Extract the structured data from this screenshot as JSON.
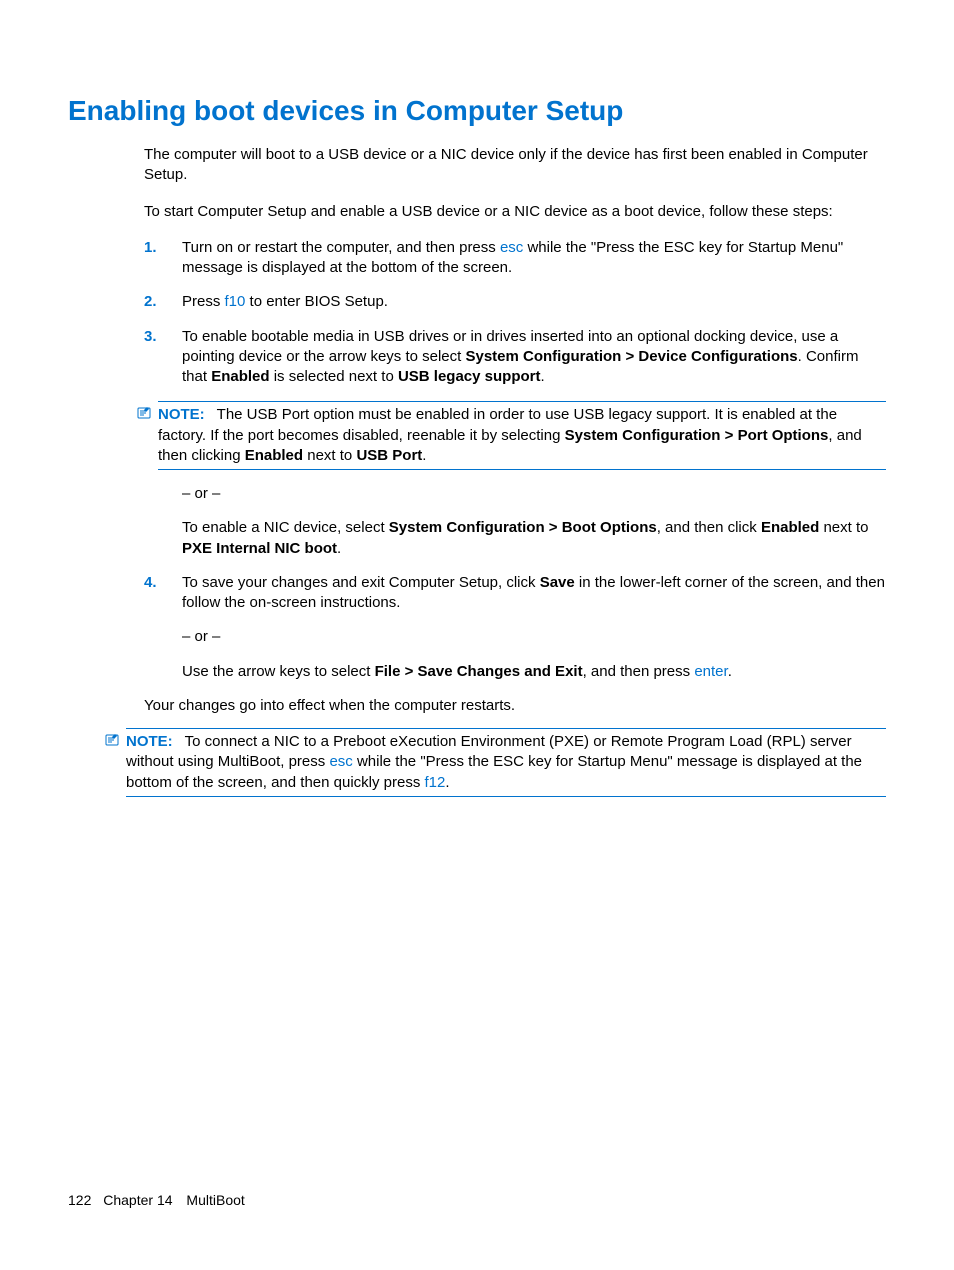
{
  "heading": "Enabling boot devices in Computer Setup",
  "intro": {
    "p1": "The computer will boot to a USB device or a NIC device only if the device has first been enabled in Computer Setup.",
    "p2": "To start Computer Setup and enable a USB device or a NIC device as a boot device, follow these steps:"
  },
  "steps": {
    "s1": {
      "num": "1.",
      "a": "Turn on or restart the computer, and then press ",
      "k": "esc",
      "b": " while the \"Press the ESC key for Startup Menu\" message is displayed at the bottom of the screen."
    },
    "s2": {
      "num": "2.",
      "a": "Press ",
      "k": "f10",
      "b": " to enter BIOS Setup."
    },
    "s3": {
      "num": "3.",
      "a": "To enable bootable media in USB drives or in drives inserted into an optional docking device, use a pointing device or the arrow keys to select ",
      "b1": "System Configuration > Device Configurations",
      "c": ". Confirm that ",
      "b2": "Enabled",
      "d": " is selected next to ",
      "b3": "USB legacy support",
      "e": "."
    },
    "note1": {
      "label": "NOTE:",
      "a": "The USB Port option must be enabled in order to use USB legacy support. It is enabled at the factory. If the port becomes disabled, reenable it by selecting ",
      "b1": "System Configuration > Port Options",
      "c": ", and then clicking ",
      "b2": "Enabled",
      "d": " next to ",
      "b3": "USB Port",
      "e": "."
    },
    "s3b": {
      "or": "– or –",
      "a": "To enable a NIC device, select ",
      "b1": "System Configuration > Boot Options",
      "c": ", and then click ",
      "b2": "Enabled",
      "d": " next to ",
      "b3": "PXE Internal NIC boot",
      "e": "."
    },
    "s4": {
      "num": "4.",
      "a": "To save your changes and exit Computer Setup, click ",
      "b1": "Save",
      "c": " in the lower-left corner of the screen, and then follow the on-screen instructions.",
      "or": "– or –",
      "d": "Use the arrow keys to select ",
      "b2": "File > Save Changes and Exit",
      "e": ", and then press ",
      "k": "enter",
      "f": "."
    }
  },
  "closing": "Your changes go into effect when the computer restarts.",
  "note2": {
    "label": "NOTE:",
    "a": "To connect a NIC to a Preboot eXecution Environment (PXE) or Remote Program Load (RPL) server without using MultiBoot, press ",
    "k1": "esc",
    "b": " while the \"Press the ESC key for Startup Menu\" message is displayed at the bottom of the screen, and then quickly press ",
    "k2": "f12",
    "c": "."
  },
  "footer": {
    "page": "122",
    "chapter": "Chapter 14",
    "title": "MultiBoot"
  }
}
